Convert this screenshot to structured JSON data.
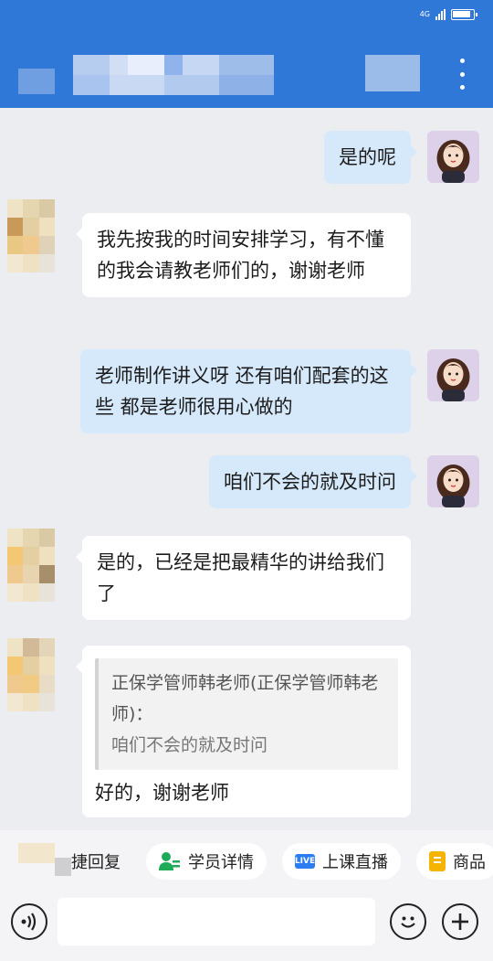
{
  "header": {
    "title": "",
    "more_icon": "more-vertical-icon",
    "status_icons": [
      "signal-icon",
      "battery-icon"
    ],
    "network_label": "4G"
  },
  "messages": [
    {
      "from": "teacher",
      "text": "是的呢"
    },
    {
      "from": "student",
      "text": "我先按我的时间安排学习，有不懂的我会请教老师们的，谢谢老师"
    },
    {
      "from": "teacher",
      "text": "老师制作讲义呀 还有咱们配套的这些 都是老师很用心做的"
    },
    {
      "from": "teacher",
      "text": "咱们不会的就及时问"
    },
    {
      "from": "student",
      "text": "是的，已经是把最精华的讲给我们了"
    },
    {
      "from": "student",
      "quote": {
        "author": "正保学管师韩老师(正保学管师韩老师)：",
        "text": "咱们不会的就及时问"
      },
      "text": "好的，谢谢老师"
    }
  ],
  "quick_actions": [
    {
      "label": "捷回复",
      "icon": ""
    },
    {
      "label": "学员详情",
      "icon": "person-detail-icon"
    },
    {
      "label": "上课直播",
      "icon": "live-icon",
      "badge": "LIVE"
    },
    {
      "label": "商品",
      "icon": "goods-icon"
    }
  ],
  "input": {
    "value": "",
    "placeholder": ""
  },
  "colors": {
    "header": "#2f78d8",
    "outgoing_bubble": "#d6e9fb",
    "incoming_bubble": "#ffffff",
    "background": "#ebedf0"
  }
}
